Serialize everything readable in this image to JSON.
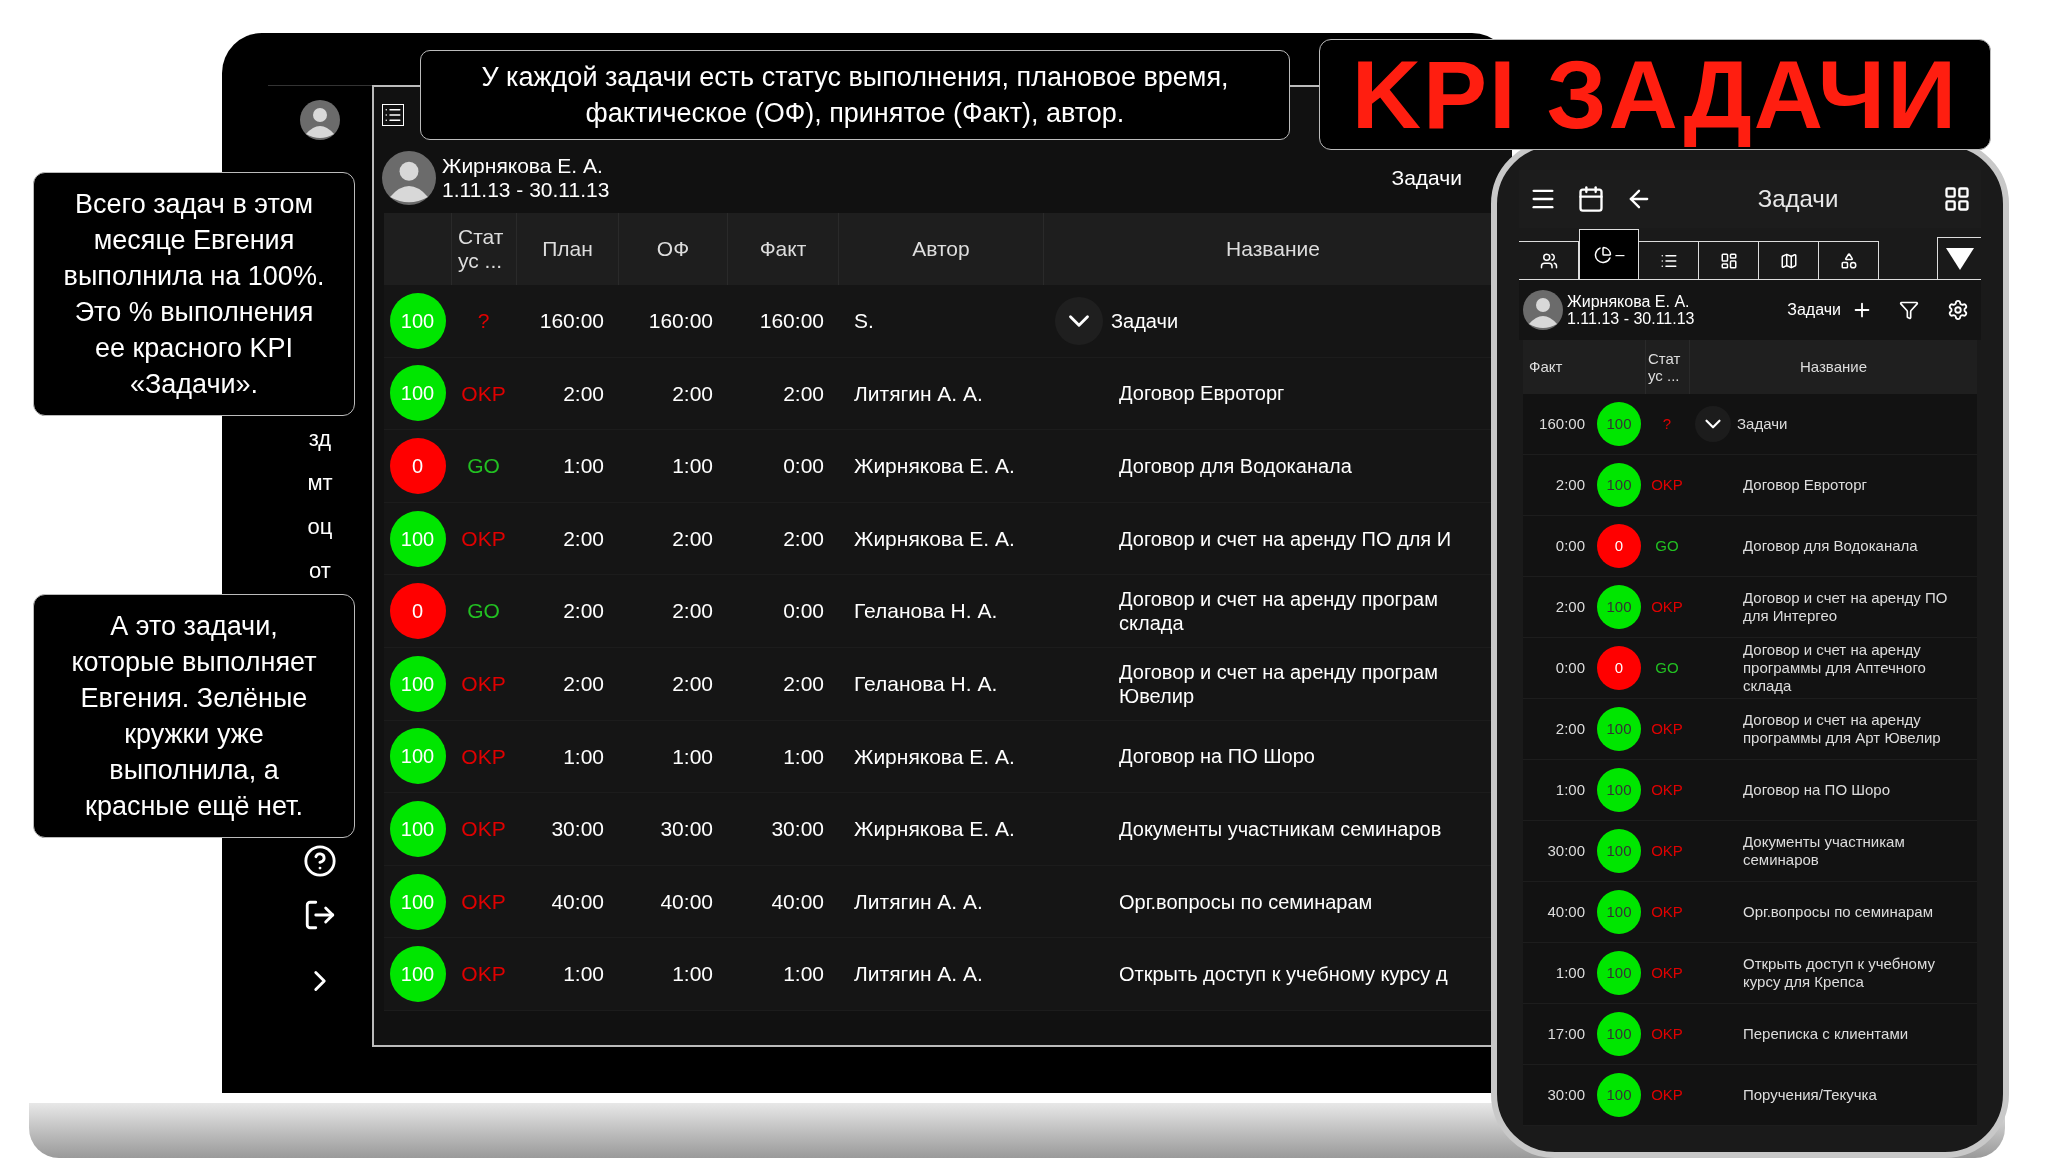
{
  "headline": "KPI ЗАДАЧИ",
  "callouts": [
    {
      "text": "У каждой задачи есть статус выполнения, плановое время, фактическое (ОФ), принятое (Факт), автор."
    },
    {
      "text": "Всего задач в этом месяце Евгения выполнила на 100%. Это % выполнения ее красного KPI «Задачи»."
    },
    {
      "text": "А это задачи, которые выполняет Евгения. Зелёные кружки уже выполнила, а красные ещё нет."
    }
  ],
  "laptop": {
    "sidebar": {
      "items": [
        "зд",
        "мт",
        "оц",
        "от"
      ]
    },
    "user": {
      "name": "Жирнякова Е. А.",
      "period": "1.11.13 - 30.11.13"
    },
    "section": "Задачи",
    "table": {
      "columns": [
        "Стат ус ...",
        "План",
        "ОФ",
        "Факт",
        "Автор",
        "Название"
      ],
      "rows": [
        {
          "kind": "group",
          "done": true,
          "score": "100",
          "status": "?",
          "plan": "160:00",
          "of": "160:00",
          "fact": "160:00",
          "author": "S.",
          "name": "Задачи"
        },
        {
          "kind": "task",
          "done": true,
          "score": "100",
          "status": "OKP",
          "plan": "2:00",
          "of": "2:00",
          "fact": "2:00",
          "author": "Литягин А. А.",
          "name": "Договор Евроторг"
        },
        {
          "kind": "task",
          "done": false,
          "score": "0",
          "status": "GO",
          "plan": "1:00",
          "of": "1:00",
          "fact": "0:00",
          "author": "Жирнякова Е. А.",
          "name": "Договор для Водоканала"
        },
        {
          "kind": "task",
          "done": true,
          "score": "100",
          "status": "OKP",
          "plan": "2:00",
          "of": "2:00",
          "fact": "2:00",
          "author": "Жирнякова Е. А.",
          "name": "Договор и счет на аренду ПО для И"
        },
        {
          "kind": "task",
          "done": false,
          "score": "0",
          "status": "GO",
          "plan": "2:00",
          "of": "2:00",
          "fact": "0:00",
          "author": "Геланова Н. А.",
          "name": "Договор и счет на аренду програм\nсклада"
        },
        {
          "kind": "task",
          "done": true,
          "score": "100",
          "status": "OKP",
          "plan": "2:00",
          "of": "2:00",
          "fact": "2:00",
          "author": "Геланова Н. А.",
          "name": "Договор и счет на аренду програм\nЮвелир"
        },
        {
          "kind": "task",
          "done": true,
          "score": "100",
          "status": "OKP",
          "plan": "1:00",
          "of": "1:00",
          "fact": "1:00",
          "author": "Жирнякова Е. А.",
          "name": "Договор на ПО Шоро"
        },
        {
          "kind": "task",
          "done": true,
          "score": "100",
          "status": "OKP",
          "plan": "30:00",
          "of": "30:00",
          "fact": "30:00",
          "author": "Жирнякова Е. А.",
          "name": "Документы участникам семинаров"
        },
        {
          "kind": "task",
          "done": true,
          "score": "100",
          "status": "OKP",
          "plan": "40:00",
          "of": "40:00",
          "fact": "40:00",
          "author": "Литягин А. А.",
          "name": "Орг.вопросы по семинарам"
        },
        {
          "kind": "task",
          "done": true,
          "score": "100",
          "status": "OKP",
          "plan": "1:00",
          "of": "1:00",
          "fact": "1:00",
          "author": "Литягин А. А.",
          "name": "Открыть доступ к учебному курсу д"
        }
      ]
    }
  },
  "phone": {
    "title": "Задачи",
    "tabs": [
      {
        "selected": false
      },
      {
        "selected": true,
        "label": "–"
      },
      {
        "selected": false
      },
      {
        "selected": false
      },
      {
        "selected": false
      },
      {
        "selected": false
      }
    ],
    "user": {
      "name": "Жирнякова Е. А.",
      "period": "1.11.13 - 30.11.13"
    },
    "section": "Задачи",
    "table": {
      "columns": [
        "Факт",
        "Стат ус ...",
        "Название"
      ],
      "rows": [
        {
          "kind": "group",
          "done": true,
          "fact": "160:00",
          "score": "100",
          "status": "?",
          "name": "Задачи"
        },
        {
          "kind": "task",
          "done": true,
          "fact": "2:00",
          "score": "100",
          "status": "OKP",
          "name": "Договор Евроторг"
        },
        {
          "kind": "task",
          "done": false,
          "fact": "0:00",
          "score": "0",
          "status": "GO",
          "name": "Договор для Водоканала"
        },
        {
          "kind": "task",
          "done": true,
          "fact": "2:00",
          "score": "100",
          "status": "OKP",
          "name": "Договор и счет на аренду ПО для Интергео"
        },
        {
          "kind": "task",
          "done": false,
          "fact": "0:00",
          "score": "0",
          "status": "GO",
          "name": "Договор и счет на аренду программы для Аптечного склада"
        },
        {
          "kind": "task",
          "done": true,
          "fact": "2:00",
          "score": "100",
          "status": "OKP",
          "name": "Договор и счет на аренду программы для Арт Ювелир"
        },
        {
          "kind": "task",
          "done": true,
          "fact": "1:00",
          "score": "100",
          "status": "OKP",
          "name": "Договор на ПО Шоро"
        },
        {
          "kind": "task",
          "done": true,
          "fact": "30:00",
          "score": "100",
          "status": "OKP",
          "name": "Документы участникам семинаров"
        },
        {
          "kind": "task",
          "done": true,
          "fact": "40:00",
          "score": "100",
          "status": "OKP",
          "name": "Орг.вопросы по семинарам"
        },
        {
          "kind": "task",
          "done": true,
          "fact": "1:00",
          "score": "100",
          "status": "OKP",
          "name": "Открыть доступ к учебному курсу для Крепса"
        },
        {
          "kind": "task",
          "done": true,
          "fact": "17:00",
          "score": "100",
          "status": "OKP",
          "name": "Переписка с клиентами"
        },
        {
          "kind": "task",
          "done": true,
          "fact": "30:00",
          "score": "100",
          "status": "OKP",
          "name": "Поручения/Текучка"
        }
      ]
    }
  }
}
